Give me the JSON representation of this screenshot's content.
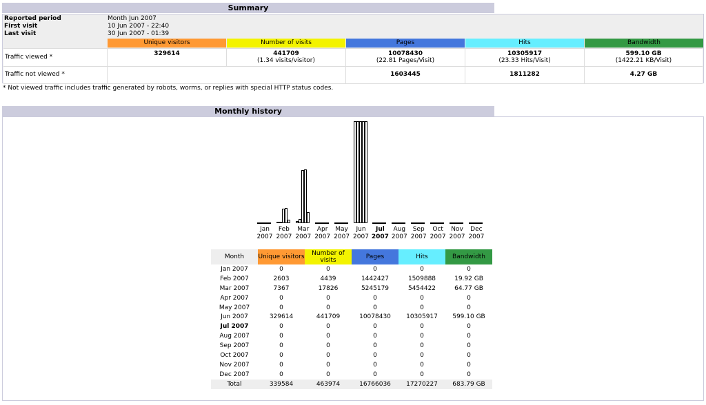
{
  "summary": {
    "title": "Summary",
    "reported_period_label": "Reported period",
    "reported_period_value": "Month Jun 2007",
    "first_visit_label": "First visit",
    "first_visit_value": "10 Jun 2007 - 22:40",
    "last_visit_label": "Last visit",
    "last_visit_value": "30 Jun 2007 - 01:39",
    "headers": {
      "unique_visitors": "Unique visitors",
      "number_of_visits": "Number of visits",
      "pages": "Pages",
      "hits": "Hits",
      "bandwidth": "Bandwidth"
    },
    "traffic_viewed": {
      "label": "Traffic viewed *",
      "unique_visitors": "329614",
      "visits": "441709",
      "visits_sub": "(1.34 visits/visitor)",
      "pages": "10078430",
      "pages_sub": "(22.81 Pages/Visit)",
      "hits": "10305917",
      "hits_sub": "(23.33 Hits/Visit)",
      "bandwidth": "599.10 GB",
      "bandwidth_sub": "(1422.21 KB/Visit)"
    },
    "traffic_not_viewed": {
      "label": "Traffic not viewed *",
      "pages": "1603445",
      "hits": "1811282",
      "bandwidth": "4.27 GB"
    },
    "footnote": "* Not viewed traffic includes traffic generated by robots, worms, or replies with special HTTP status codes."
  },
  "history": {
    "title": "Monthly history",
    "chart_months": [
      {
        "m": "Jan",
        "y": "2007"
      },
      {
        "m": "Feb",
        "y": "2007"
      },
      {
        "m": "Mar",
        "y": "2007"
      },
      {
        "m": "Apr",
        "y": "2007"
      },
      {
        "m": "May",
        "y": "2007"
      },
      {
        "m": "Jun",
        "y": "2007"
      },
      {
        "m": "Jul",
        "y": "2007"
      },
      {
        "m": "Aug",
        "y": "2007"
      },
      {
        "m": "Sep",
        "y": "2007"
      },
      {
        "m": "Oct",
        "y": "2007"
      },
      {
        "m": "Nov",
        "y": "2007"
      },
      {
        "m": "Dec",
        "y": "2007"
      }
    ],
    "current_month_index": 6,
    "table_headers": {
      "month": "Month",
      "unique_visitors": "Unique visitors",
      "number_of_visits": "Number of visits",
      "pages": "Pages",
      "hits": "Hits",
      "bandwidth": "Bandwidth"
    },
    "total_label": "Total",
    "totals": {
      "unique_visitors": "339584",
      "visits": "463974",
      "pages": "16766036",
      "hits": "17270227",
      "bandwidth": "683.79 GB"
    }
  },
  "chart_data": {
    "type": "bar",
    "categories": [
      "Jan 2007",
      "Feb 2007",
      "Mar 2007",
      "Apr 2007",
      "May 2007",
      "Jun 2007",
      "Jul 2007",
      "Aug 2007",
      "Sep 2007",
      "Oct 2007",
      "Nov 2007",
      "Dec 2007"
    ],
    "series": [
      {
        "name": "Unique visitors",
        "values": [
          0,
          2603,
          7367,
          0,
          0,
          329614,
          0,
          0,
          0,
          0,
          0,
          0
        ]
      },
      {
        "name": "Number of visits",
        "values": [
          0,
          4439,
          17826,
          0,
          0,
          441709,
          0,
          0,
          0,
          0,
          0,
          0
        ]
      },
      {
        "name": "Pages",
        "values": [
          0,
          1442427,
          5245179,
          0,
          0,
          10078430,
          0,
          0,
          0,
          0,
          0,
          0
        ]
      },
      {
        "name": "Hits",
        "values": [
          0,
          1509888,
          5454422,
          0,
          0,
          10305917,
          0,
          0,
          0,
          0,
          0,
          0
        ]
      },
      {
        "name": "Bandwidth",
        "values": [
          0,
          19.92,
          64.77,
          0,
          0,
          599.1,
          0,
          0,
          0,
          0,
          0,
          0
        ]
      }
    ],
    "bandwidth_labels": [
      "0",
      "19.92 GB",
      "64.77 GB",
      "0",
      "0",
      "599.10 GB",
      "0",
      "0",
      "0",
      "0",
      "0",
      "0"
    ]
  },
  "colors": {
    "unique_visitors": "#ff9933",
    "visits": "#f3f300",
    "pages": "#4477dd",
    "hits": "#66eeff",
    "bandwidth": "#339944",
    "header_bg": "#ccccdd"
  }
}
